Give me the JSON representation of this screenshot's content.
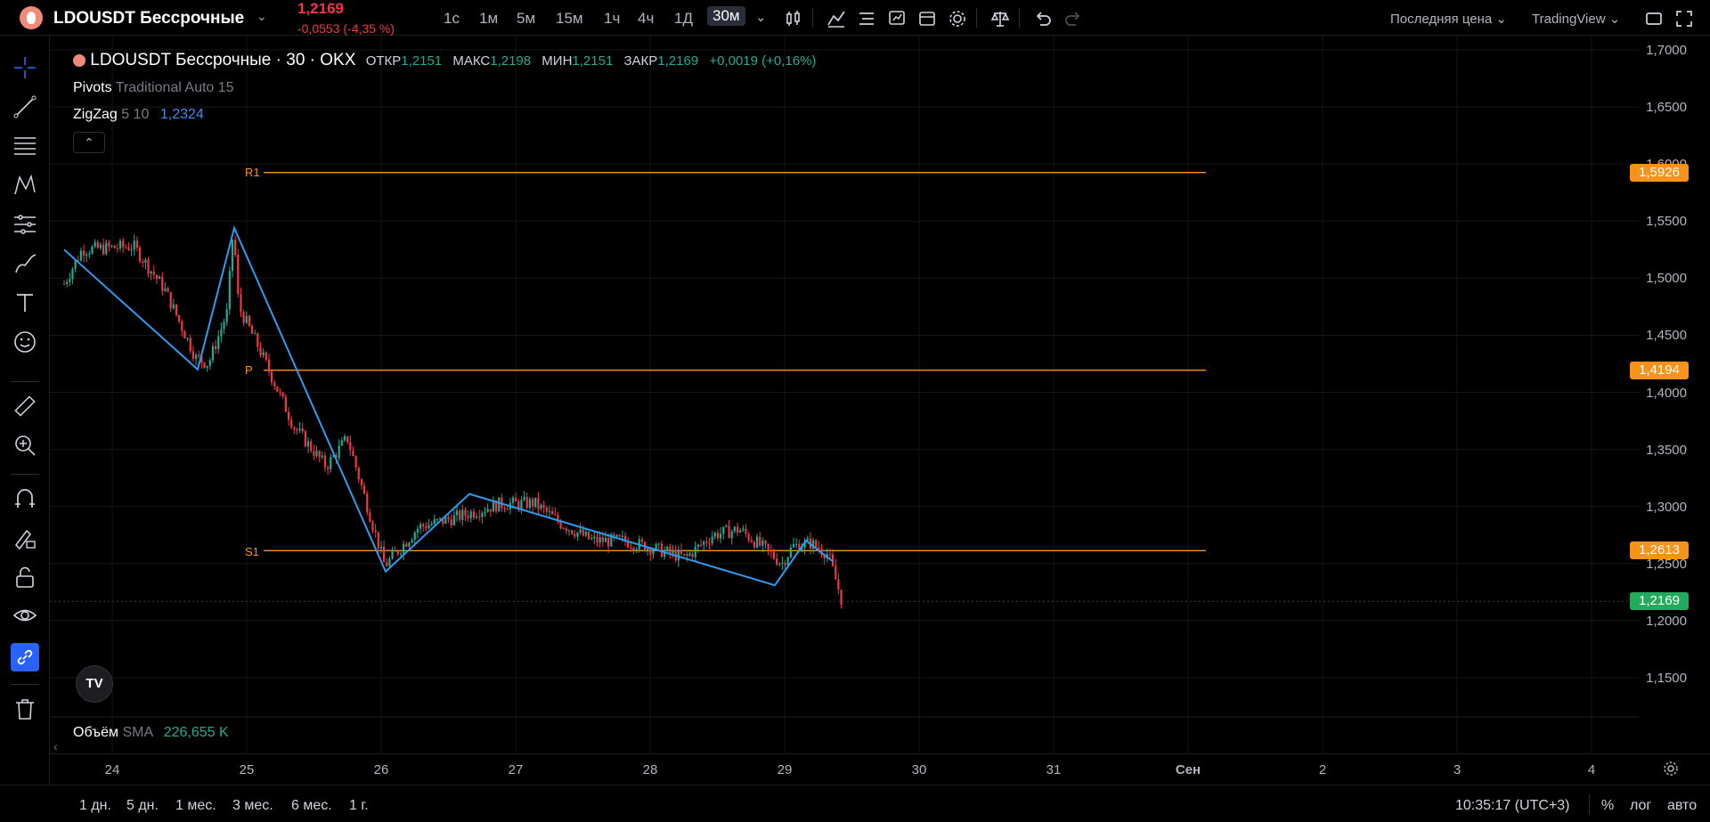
{
  "header": {
    "symbol": "LDOUSDT Бессрочные",
    "last_price": "1,2169",
    "change": "-0,0553 (-4,35 %)",
    "intervals": [
      "1с",
      "1м",
      "5м",
      "15м",
      "1ч",
      "4ч",
      "1Д",
      "30м"
    ],
    "price_source": "Последняя цена",
    "brand": "TradingView"
  },
  "legend": {
    "title": "LDOUSDT Бессрочные · 30 · OKX",
    "open_label": "ОТКР",
    "open": "1,2151",
    "high_label": "МАКС",
    "high": "1,2198",
    "low_label": "МИН",
    "low": "1,2151",
    "close_label": "ЗАКР",
    "close": "1,2169",
    "change": "+0,0019 (+0,16%)",
    "pivots_name": "Pivots",
    "pivots_params": "Traditional Auto 15",
    "zigzag_name": "ZigZag",
    "zigzag_params": "5 10",
    "zigzag_value": "1,2324"
  },
  "volume": {
    "name": "Объём",
    "type": "SMA",
    "value": "226,655 K"
  },
  "yaxis": {
    "ticks": [
      "1,7000",
      "1,6500",
      "1,6000",
      "1,5500",
      "1,5000",
      "1,4500",
      "1,4000",
      "1,3500",
      "1,3000",
      "1,2500",
      "1,2000",
      "1,1500"
    ],
    "r1": "1,5926",
    "p": "1,4194",
    "s1": "1,2613",
    "last": "1,2169"
  },
  "xaxis": {
    "ticks": [
      "24",
      "25",
      "26",
      "27",
      "28",
      "29",
      "30",
      "31",
      "Сен",
      "2",
      "3",
      "4"
    ]
  },
  "pivots": {
    "r1_label": "R1",
    "p_label": "P",
    "s1_label": "S1"
  },
  "bottom": {
    "ranges": [
      "1 дн.",
      "5 дн.",
      "1 мес.",
      "3 мес.",
      "6 мес.",
      "1 г."
    ],
    "clock": "10:35:17 (UTC+3)",
    "percent": "%",
    "log": "лог",
    "auto": "авто"
  },
  "colors": {
    "up": "#22ab94",
    "down": "#f23645",
    "pivot": "#f7931a",
    "zigzag": "#2d9cf0"
  }
}
